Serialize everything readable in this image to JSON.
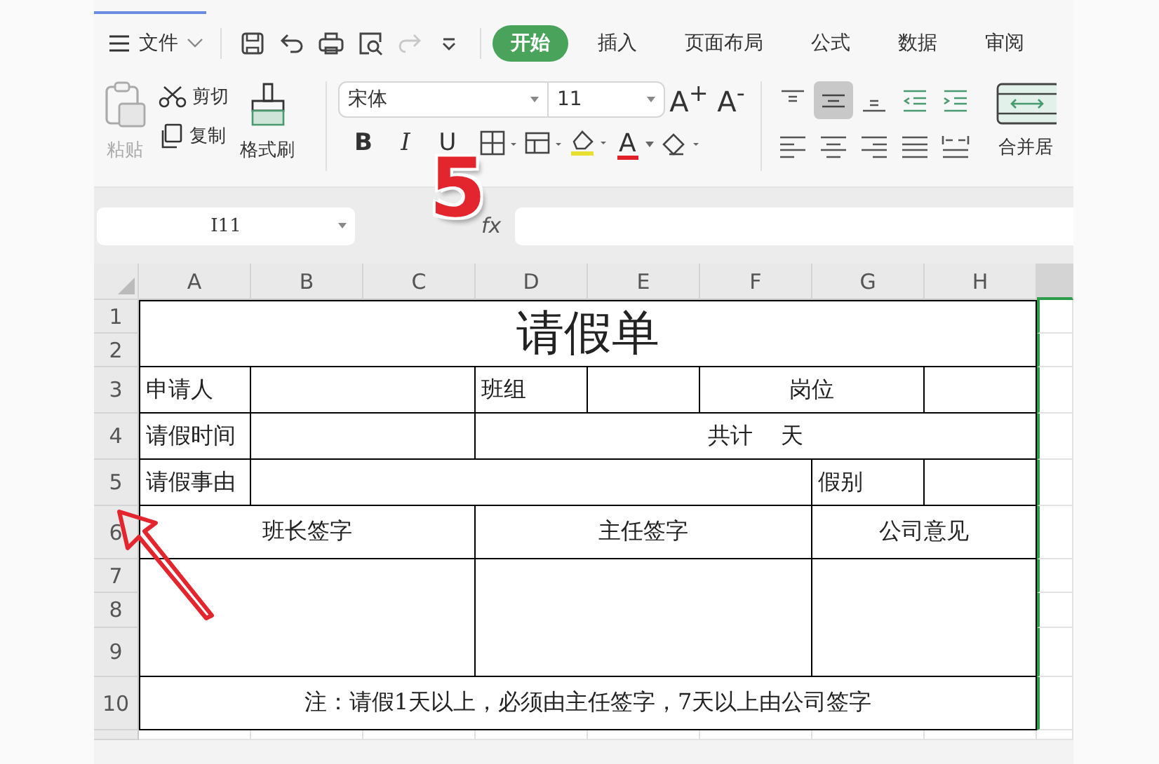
{
  "menu": {
    "file_label": "文件"
  },
  "quick_access": [
    {
      "kind": "save",
      "disabled": false
    },
    {
      "kind": "undo",
      "disabled": false
    },
    {
      "kind": "print",
      "disabled": false
    },
    {
      "kind": "preview",
      "disabled": false
    },
    {
      "kind": "redo",
      "disabled": true
    },
    {
      "kind": "more",
      "disabled": false
    }
  ],
  "tabs": [
    {
      "label": "开始",
      "selected": true
    },
    {
      "label": "插入",
      "selected": false
    },
    {
      "label": "页面布局",
      "selected": false
    },
    {
      "label": "公式",
      "selected": false
    },
    {
      "label": "数据",
      "selected": false
    },
    {
      "label": "审阅",
      "selected": false
    }
  ],
  "clipboard": {
    "paste": {
      "label": "粘贴",
      "disabled": true
    },
    "cut": "剪切",
    "copy": "复制",
    "format_painter": "格式刷"
  },
  "font": {
    "name": "宋体",
    "size": "11",
    "grow": "A$^{+}$",
    "shrink": "A$^{-}$",
    "styles": [
      "B",
      "I",
      "U"
    ],
    "font_color": "A"
  },
  "alignment": [
    {
      "kind": "top",
      "selected": false
    },
    {
      "kind": "middle",
      "selected": true
    },
    {
      "kind": "bottom",
      "selected": false
    },
    {
      "kind": "outdent",
      "selected": false
    },
    {
      "kind": "indent",
      "selected": false
    },
    {
      "kind": "left",
      "selected": false
    },
    {
      "kind": "center",
      "selected": false
    },
    {
      "kind": "right",
      "selected": false
    },
    {
      "kind": "justify",
      "selected": false
    },
    {
      "kind": "distributed",
      "selected": false
    }
  ],
  "merge_label": "合并居",
  "formula_bar": {
    "cell_ref": "I11",
    "fx": "fx"
  },
  "sheet": {
    "columns": [
      "A",
      "B",
      "C",
      "D",
      "E",
      "F",
      "G",
      "H"
    ],
    "rows": [
      {
        "label": "1",
        "cells": [
          {
            "rowspan": 2,
            "colspan": 8,
            "kind": "title",
            "text": "请假单"
          }
        ]
      },
      {
        "label": "2"
      },
      {
        "label": "3",
        "cells": [
          {
            "kind": "label",
            "text": "申请人"
          },
          {
            "colspan": 2,
            "kind": "empty"
          },
          {
            "kind": "label",
            "text": "班组"
          },
          {
            "kind": "empty"
          },
          {
            "colspan": 2,
            "kind": "caption",
            "text": "岗位"
          },
          {
            "kind": "empty"
          }
        ]
      },
      {
        "label": "4",
        "cells": [
          {
            "kind": "label",
            "text": "请假时间"
          },
          {
            "colspan": 2,
            "kind": "empty"
          },
          {
            "colspan": 5,
            "kind": "caption",
            "text": "共计    天"
          }
        ]
      },
      {
        "label": "5",
        "cells": [
          {
            "kind": "label",
            "text": "请假事由"
          },
          {
            "colspan": 5,
            "kind": "empty"
          },
          {
            "kind": "label",
            "text": "假别"
          },
          {
            "kind": "empty"
          }
        ]
      },
      {
        "label": "6",
        "cells": [
          {
            "colspan": 3,
            "kind": "caption",
            "text": "班长签字"
          },
          {
            "colspan": 3,
            "kind": "caption",
            "text": "主任签字"
          },
          {
            "colspan": 2,
            "kind": "caption",
            "text": "公司意见"
          }
        ]
      },
      {
        "label": "7",
        "cells": [
          {
            "rowspan": 3,
            "colspan": 3,
            "kind": "empty"
          },
          {
            "rowspan": 3,
            "colspan": 3,
            "kind": "empty"
          },
          {
            "rowspan": 3,
            "colspan": 2,
            "kind": "empty"
          }
        ]
      },
      {
        "label": "8"
      },
      {
        "label": "9"
      },
      {
        "label": "10",
        "cells": [
          {
            "colspan": 8,
            "kind": "caption",
            "text": "注：请假1天以上，必须由主任签字，7天以上由公司签字"
          }
        ]
      }
    ]
  },
  "annotation": {
    "step_number": "5"
  }
}
